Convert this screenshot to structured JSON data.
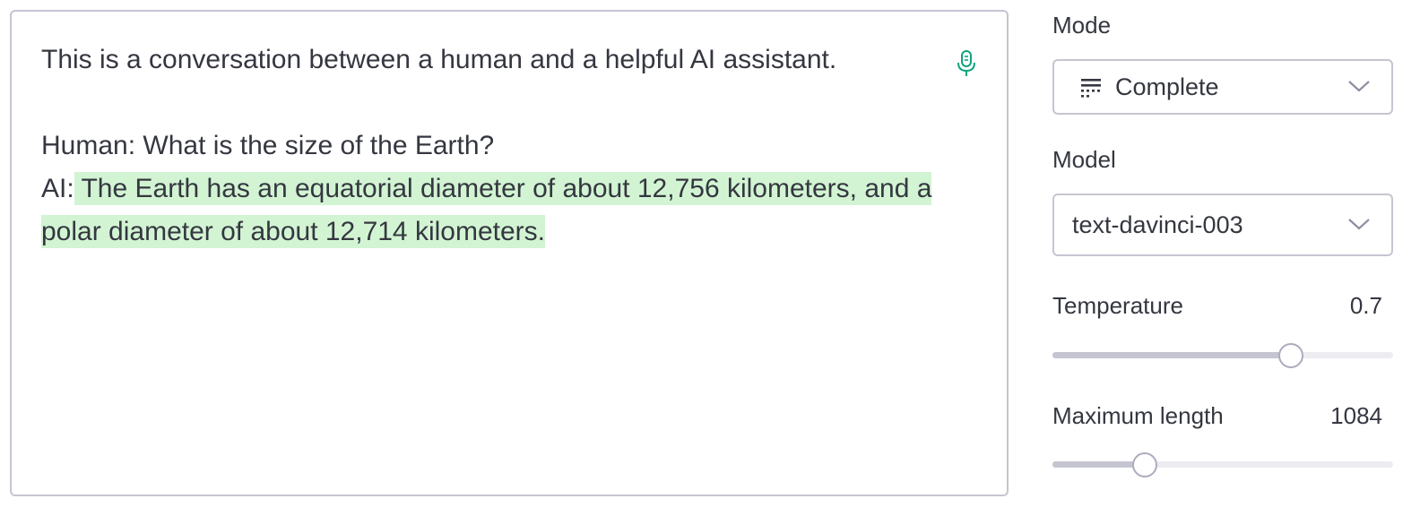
{
  "editor": {
    "line1": "This is a conversation between a human and a helpful AI assistant.",
    "human_line": "Human: What is the size of the Earth?",
    "ai_prefix": "AI:",
    "ai_completion": " The Earth has an equatorial diameter of about 12,756 kilometers, and a polar diameter of about 12,714 kilometers.",
    "mic_icon": "microphone-icon",
    "completion_highlight_color": "#d2f4d3",
    "mic_color": "#10a37f"
  },
  "sidebar": {
    "mode": {
      "label": "Mode",
      "value": "Complete",
      "icon": "complete-mode-icon"
    },
    "model": {
      "label": "Model",
      "value": "text-davinci-003"
    },
    "temperature": {
      "label": "Temperature",
      "value_text": "0.7",
      "level": 0.7
    },
    "max_length": {
      "label": "Maximum length",
      "value_text": "1084",
      "level": 0.27
    }
  }
}
